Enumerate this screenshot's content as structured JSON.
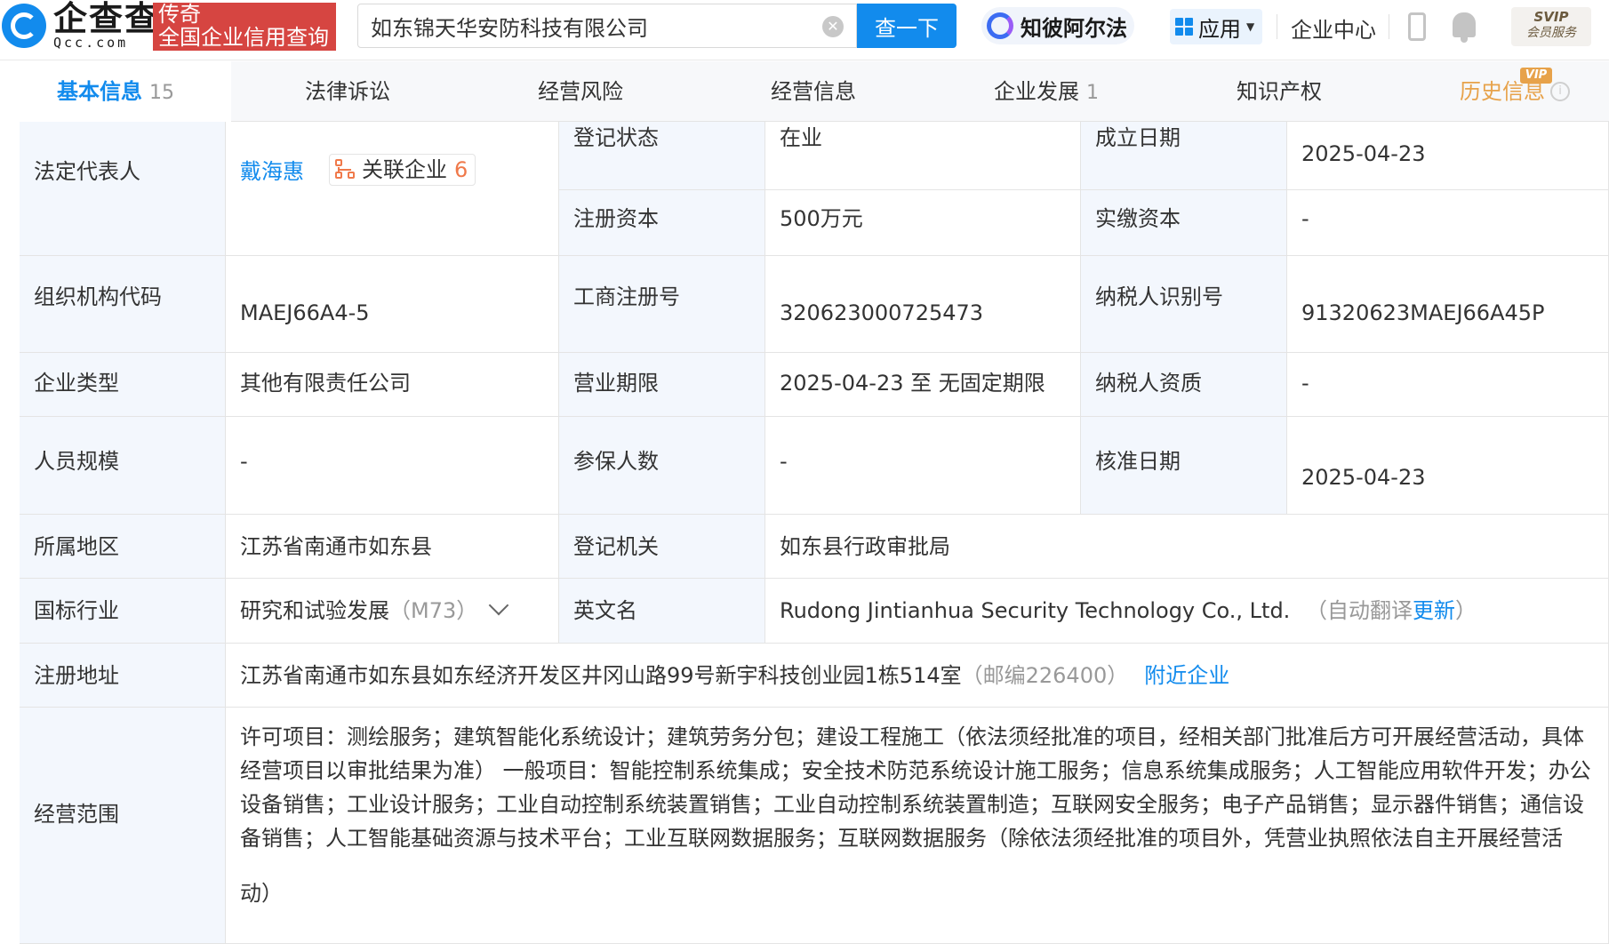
{
  "header": {
    "logo_cn": "企查查",
    "logo_en": "Qcc.com",
    "brand_badge_line1": "传奇",
    "brand_badge_line2": "全国企业信用查询",
    "search_value": "如东锦天华安防科技有限公司",
    "search_button": "查一下",
    "zhibi_label": "知彼阿尔法",
    "apps_label": "应用",
    "enterprise_center": "企业中心",
    "svip_top": "SVIP",
    "svip_bottom": "会员服务",
    "accent_color": "#128bed"
  },
  "tabs": [
    {
      "label": "基本信息",
      "count": "15"
    },
    {
      "label": "法律诉讼",
      "count": ""
    },
    {
      "label": "经营风险",
      "count": ""
    },
    {
      "label": "经营信息",
      "count": ""
    },
    {
      "label": "企业发展",
      "count": "1"
    },
    {
      "label": "知识产权",
      "count": ""
    },
    {
      "label": "历史信息",
      "count": ""
    }
  ],
  "vip_badge": "VIP",
  "rows": {
    "legal_rep_label": "法定代表人",
    "legal_rep_name": "戴海惠",
    "related_label": "关联企业",
    "related_count": "6",
    "reg_status_label": "登记状态",
    "reg_status": "在业",
    "founded_label": "成立日期",
    "founded": "2025-04-23",
    "reg_capital_label": "注册资本",
    "reg_capital": "500万元",
    "paid_capital_label": "实缴资本",
    "paid_capital": "-",
    "org_code_label": "组织机构代码",
    "org_code": "MAEJ66A4-5",
    "biz_reg_no_label": "工商注册号",
    "biz_reg_no": "320623000725473",
    "taxpayer_id_label": "纳税人识别号",
    "taxpayer_id": "91320623MAEJ66A45P",
    "company_type_label": "企业类型",
    "company_type": "其他有限责任公司",
    "biz_term_label": "营业期限",
    "biz_term": "2025-04-23 至 无固定期限",
    "taxpayer_qual_label": "纳税人资质",
    "taxpayer_qual": "-",
    "staff_size_label": "人员规模",
    "staff_size": "-",
    "insured_label": "参保人数",
    "insured": "-",
    "approved_label": "核准日期",
    "approved": "2025-04-23",
    "region_label": "所属地区",
    "region": "江苏省南通市如东县",
    "authority_label": "登记机关",
    "authority": "如东县行政审批局",
    "industry_label": "国标行业",
    "industry": "研究和试验发展",
    "industry_code": "（M73）",
    "english_label": "英文名",
    "english_name": "Rudong Jintianhua Security Technology Co., Ltd.",
    "auto_translate": "（自动翻译",
    "update_link": "更新",
    "auto_translate_end": "）",
    "address_label": "注册地址",
    "address": "江苏省南通市如东县如东经济开发区井冈山路99号新宇科技创业园1栋514室",
    "postcode": "（邮编226400）",
    "nearby_link": "附近企业",
    "scope_label": "经营范围",
    "scope_line1": "许可项目：测绘服务；建筑智能化系统设计；建筑劳务分包；建设工程施工（依法须经批准的项目，经相关部门批准后方可开展经营活动，具体",
    "scope_line2": "经营项目以审批结果为准） 一般项目：智能控制系统集成；安全技术防范系统设计施工服务；信息系统集成服务；人工智能应用软件开发；办公",
    "scope_line3": "设备销售；工业设计服务；工业自动控制系统装置销售；工业自动控制系统装置制造；互联网安全服务；电子产品销售；显示器件销售；通信设",
    "scope_line4": "备销售；人工智能基础资源与技术平台；工业互联网数据服务；互联网数据服务（除依法须经批准的项目外，凭营业执照依法自主开展经营活",
    "scope_line5": "动）"
  }
}
